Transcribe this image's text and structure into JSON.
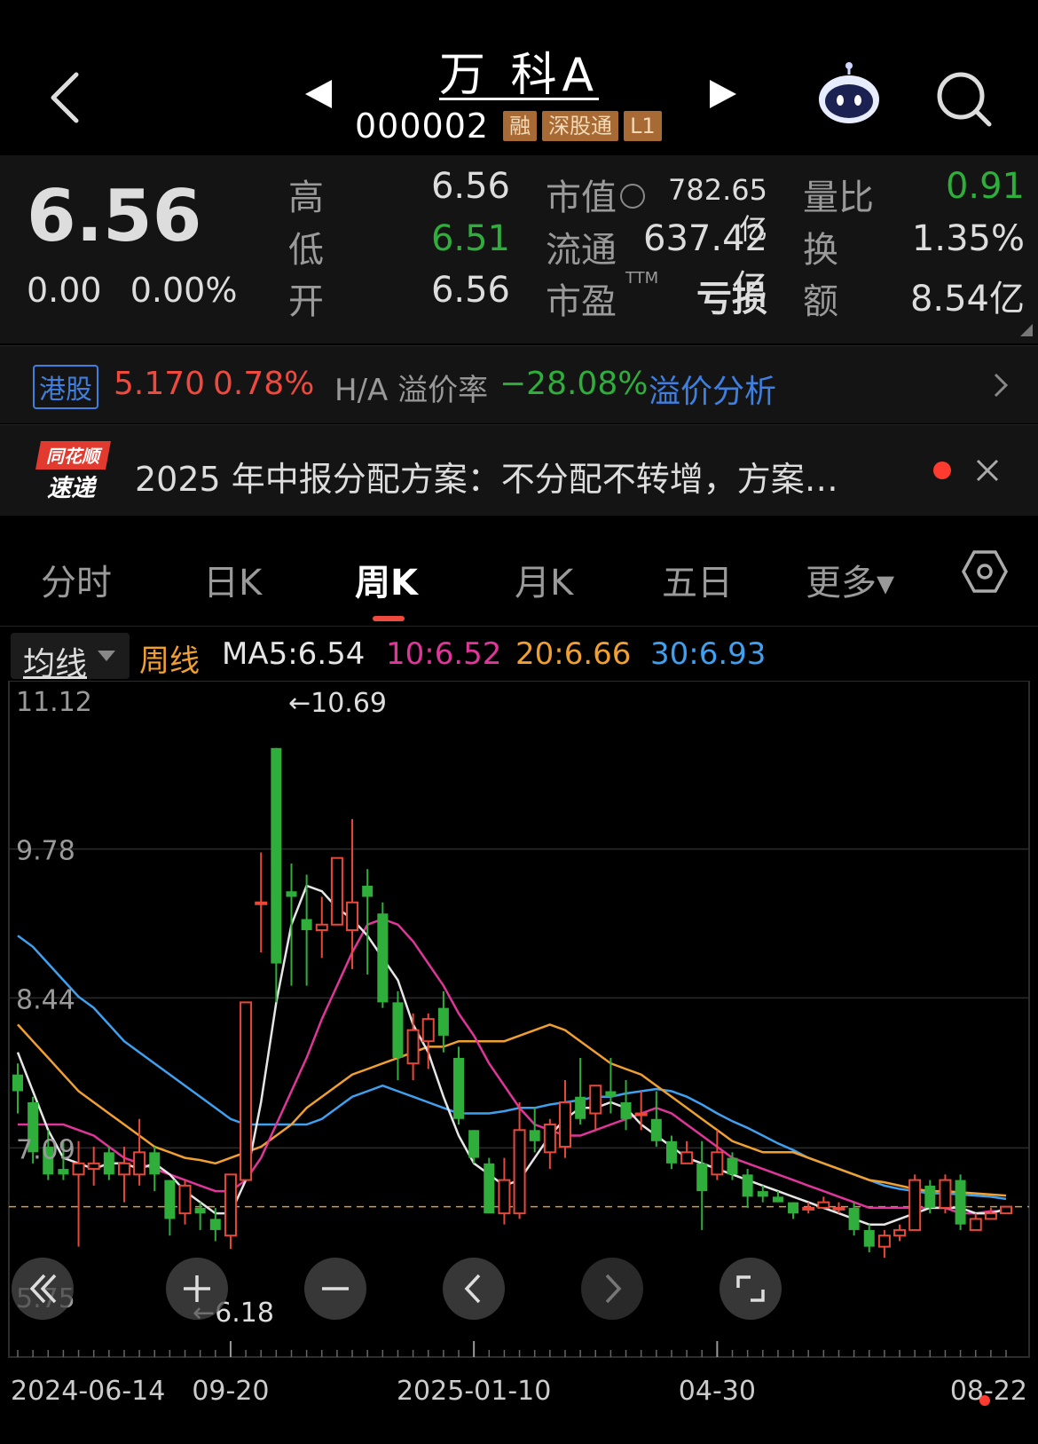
{
  "header": {
    "stock_name": "万 科A",
    "stock_code": "000002",
    "badges": [
      "融",
      "深股通",
      "L1"
    ]
  },
  "quote": {
    "price": "6.56",
    "change": "0.00",
    "change_pct": "0.00%",
    "labels": {
      "high": "高",
      "low": "低",
      "open": "开",
      "market_cap": "市值",
      "float_cap": "流通",
      "pe": "市盈",
      "pe_ttm": "TTM",
      "volume_ratio": "量比",
      "turnover": "换",
      "amount": "额"
    },
    "values": {
      "high": "6.56",
      "low": "6.51",
      "open": "6.56",
      "market_cap": "782.65亿",
      "float_cap": "637.42亿",
      "pe": "亏损",
      "volume_ratio": "0.91",
      "turnover": "1.35%",
      "amount": "8.54亿"
    }
  },
  "hk": {
    "badge": "港股",
    "price": "5.170",
    "pct": "0.78%",
    "ha_label": "H/A 溢价率",
    "ha_value": "−28.08%",
    "link": "溢价分析"
  },
  "news": {
    "logo_top": "同花顺",
    "logo_bottom": "速递",
    "text": "2025 年中报分配方案：不分配不转增，方案…"
  },
  "tabs": [
    "分时",
    "日K",
    "周K",
    "月K",
    "五日",
    "更多▾"
  ],
  "active_tab": "周K",
  "ma": {
    "select_label": "均线",
    "period_label": "周线",
    "ma5": "MA5:6.54",
    "ma10": "10:6.52",
    "ma20": "20:6.66",
    "ma30": "30:6.93",
    "colors": {
      "ma5": "#e6e6e6",
      "ma10": "#e0359a",
      "ma20": "#f0a030",
      "ma30": "#3fa0f0"
    }
  },
  "chart_data": {
    "type": "candlestick",
    "period": "weekly",
    "y_ticks": [
      11.12,
      9.78,
      8.44,
      7.09,
      5.75
    ],
    "ylim": [
      5.75,
      11.12
    ],
    "x_labels": [
      "2024-06-14",
      "09-20",
      "2025-01-10",
      "04-30",
      "08-22"
    ],
    "high_annotation": "←10.69",
    "low_annotation": "←6.18",
    "current_price_line": 6.56,
    "candles": [
      [
        7.75,
        7.6,
        7.85,
        7.4
      ],
      [
        7.5,
        7.05,
        7.55,
        6.95
      ],
      [
        7.1,
        6.85,
        7.25,
        6.8
      ],
      [
        6.9,
        6.85,
        7.15,
        6.8
      ],
      [
        6.85,
        6.95,
        7.15,
        6.2
      ],
      [
        6.9,
        6.95,
        7.1,
        6.75
      ],
      [
        7.05,
        6.85,
        7.1,
        6.8
      ],
      [
        6.85,
        6.95,
        7.1,
        6.6
      ],
      [
        6.85,
        7.05,
        7.35,
        6.75
      ],
      [
        7.05,
        6.85,
        7.1,
        6.7
      ],
      [
        6.8,
        6.45,
        6.8,
        6.3
      ],
      [
        6.5,
        6.75,
        6.8,
        6.4
      ],
      [
        6.55,
        6.5,
        6.6,
        6.35
      ],
      [
        6.45,
        6.35,
        6.55,
        6.25
      ],
      [
        6.3,
        6.85,
        6.85,
        6.18
      ],
      [
        6.8,
        8.4,
        8.4,
        6.8
      ],
      [
        9.3,
        9.3,
        9.75,
        8.85
      ],
      [
        10.69,
        8.75,
        10.69,
        8.4
      ],
      [
        9.4,
        9.35,
        9.65,
        8.55
      ],
      [
        9.15,
        9.05,
        9.55,
        8.55
      ],
      [
        9.05,
        9.1,
        9.35,
        8.8
      ],
      [
        9.1,
        9.7,
        9.7,
        9.35
      ],
      [
        9.05,
        9.3,
        10.05,
        8.7
      ],
      [
        9.45,
        9.35,
        9.6,
        8.65
      ],
      [
        9.2,
        8.4,
        9.3,
        8.35
      ],
      [
        8.4,
        7.9,
        8.5,
        7.7
      ],
      [
        7.85,
        8.15,
        8.3,
        7.7
      ],
      [
        8.05,
        8.25,
        8.3,
        7.8
      ],
      [
        8.35,
        8.1,
        8.5,
        7.95
      ],
      [
        7.9,
        7.35,
        8.0,
        7.3
      ],
      [
        7.25,
        7.0,
        7.25,
        6.95
      ],
      [
        6.95,
        6.5,
        7.0,
        6.5
      ],
      [
        6.5,
        6.8,
        7.0,
        6.4
      ],
      [
        6.5,
        7.25,
        7.5,
        6.45
      ],
      [
        7.25,
        7.15,
        7.45,
        7.05
      ],
      [
        7.05,
        7.3,
        7.35,
        6.9
      ],
      [
        7.1,
        7.5,
        7.7,
        7.0
      ],
      [
        7.55,
        7.35,
        7.9,
        7.3
      ],
      [
        7.4,
        7.65,
        7.65,
        7.25
      ],
      [
        7.6,
        7.55,
        7.9,
        7.4
      ],
      [
        7.5,
        7.35,
        7.7,
        7.25
      ],
      [
        7.4,
        7.4,
        7.6,
        7.25
      ],
      [
        7.35,
        7.15,
        7.6,
        7.1
      ],
      [
        7.15,
        6.95,
        7.2,
        6.9
      ],
      [
        6.95,
        7.05,
        7.15,
        6.95
      ],
      [
        6.95,
        6.7,
        7.15,
        6.35
      ],
      [
        6.85,
        7.05,
        7.25,
        6.8
      ],
      [
        7.0,
        6.85,
        7.05,
        6.8
      ],
      [
        6.85,
        6.65,
        6.9,
        6.55
      ],
      [
        6.7,
        6.65,
        6.75,
        6.6
      ],
      [
        6.65,
        6.6,
        6.7,
        6.6
      ],
      [
        6.6,
        6.5,
        6.6,
        6.45
      ],
      [
        6.55,
        6.55,
        6.6,
        6.5
      ],
      [
        6.55,
        6.6,
        6.65,
        6.55
      ],
      [
        6.55,
        6.55,
        6.6,
        6.5
      ],
      [
        6.55,
        6.35,
        6.6,
        6.3
      ],
      [
        6.35,
        6.2,
        6.4,
        6.15
      ],
      [
        6.2,
        6.3,
        6.35,
        6.1
      ],
      [
        6.3,
        6.35,
        6.4,
        6.25
      ],
      [
        6.35,
        6.8,
        6.85,
        6.35
      ],
      [
        6.75,
        6.55,
        6.8,
        6.5
      ],
      [
        6.55,
        6.8,
        6.85,
        6.5
      ],
      [
        6.8,
        6.4,
        6.85,
        6.35
      ],
      [
        6.35,
        6.45,
        6.5,
        6.35
      ],
      [
        6.45,
        6.5,
        6.55,
        6.45
      ],
      [
        6.5,
        6.56,
        6.56,
        6.51
      ]
    ],
    "ma5": [
      7.95,
      7.6,
      7.25,
      7.0,
      6.95,
      6.9,
      6.95,
      6.95,
      6.9,
      6.95,
      6.85,
      6.7,
      6.6,
      6.5,
      6.5,
      6.8,
      7.5,
      8.4,
      9.1,
      9.45,
      9.4,
      9.25,
      9.15,
      9.0,
      8.8,
      8.6,
      8.2,
      7.95,
      7.55,
      7.2,
      6.95,
      6.85,
      6.75,
      6.8,
      7.0,
      7.2,
      7.35,
      7.45,
      7.45,
      7.5,
      7.45,
      7.3,
      7.2,
      7.1,
      7.0,
      6.95,
      6.9,
      6.85,
      6.8,
      6.75,
      6.7,
      6.65,
      6.6,
      6.55,
      6.5,
      6.45,
      6.4,
      6.4,
      6.45,
      6.5,
      6.55,
      6.55,
      6.55,
      6.5,
      6.5,
      6.54
    ],
    "ma10": [
      7.3,
      7.3,
      7.3,
      7.3,
      7.25,
      7.2,
      7.1,
      7.0,
      6.95,
      6.9,
      6.85,
      6.8,
      6.75,
      6.7,
      6.7,
      6.8,
      7.0,
      7.3,
      7.6,
      7.9,
      8.25,
      8.55,
      8.85,
      9.1,
      9.15,
      9.1,
      8.95,
      8.75,
      8.55,
      8.3,
      8.1,
      7.85,
      7.65,
      7.45,
      7.3,
      7.25,
      7.2,
      7.2,
      7.25,
      7.3,
      7.35,
      7.4,
      7.45,
      7.4,
      7.3,
      7.2,
      7.1,
      7.0,
      6.95,
      6.9,
      6.85,
      6.8,
      6.75,
      6.7,
      6.65,
      6.6,
      6.55,
      6.55,
      6.55,
      6.55,
      6.55,
      6.55,
      6.5,
      6.5,
      6.52,
      6.52
    ],
    "ma20": [
      8.2,
      8.05,
      7.9,
      7.75,
      7.6,
      7.5,
      7.4,
      7.3,
      7.2,
      7.1,
      7.05,
      7.0,
      6.98,
      6.95,
      7.0,
      7.05,
      7.1,
      7.2,
      7.3,
      7.45,
      7.55,
      7.65,
      7.75,
      7.8,
      7.85,
      7.9,
      7.95,
      8.0,
      8.0,
      8.05,
      8.05,
      8.05,
      8.05,
      8.1,
      8.15,
      8.2,
      8.15,
      8.05,
      7.95,
      7.85,
      7.8,
      7.75,
      7.65,
      7.55,
      7.45,
      7.35,
      7.25,
      7.15,
      7.1,
      7.05,
      7.05,
      7.05,
      7.0,
      6.95,
      6.9,
      6.85,
      6.8,
      6.78,
      6.75,
      6.72,
      6.7,
      6.7,
      6.69,
      6.68,
      6.67,
      6.66
    ],
    "ma30": [
      9.0,
      8.9,
      8.75,
      8.6,
      8.45,
      8.35,
      8.2,
      8.05,
      7.95,
      7.85,
      7.75,
      7.65,
      7.55,
      7.45,
      7.35,
      7.3,
      7.3,
      7.3,
      7.3,
      7.3,
      7.35,
      7.45,
      7.55,
      7.6,
      7.65,
      7.6,
      7.55,
      7.5,
      7.45,
      7.4,
      7.4,
      7.4,
      7.42,
      7.45,
      7.45,
      7.48,
      7.5,
      7.52,
      7.55,
      7.55,
      7.58,
      7.6,
      7.62,
      7.6,
      7.55,
      7.48,
      7.4,
      7.33,
      7.27,
      7.2,
      7.13,
      7.07,
      7.0,
      6.95,
      6.9,
      6.85,
      6.8,
      6.75,
      6.72,
      6.7,
      6.68,
      6.68,
      6.67,
      6.66,
      6.65,
      6.63
    ],
    "colors": {
      "up": "#e8483a",
      "down": "#2fae3b",
      "grid": "#2c2c2c",
      "price_line": "#d8a030"
    }
  },
  "controls": [
    "rewind",
    "zoom-in",
    "zoom-out",
    "previous",
    "next",
    "fullscreen"
  ]
}
